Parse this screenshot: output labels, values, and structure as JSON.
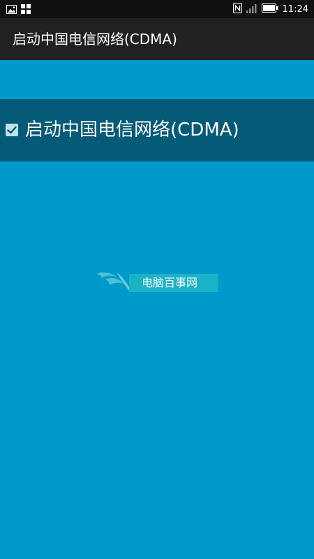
{
  "status_bar": {
    "time": "11:24",
    "icons": [
      "image-icon",
      "apps-grid-icon",
      "nfc-icon",
      "signal-icon",
      "battery-icon"
    ]
  },
  "title_bar": {
    "title": "启动中国电信网络(CDMA)"
  },
  "option": {
    "label": "启动中国电信网络(CDMA)",
    "checked": true
  },
  "watermark": {
    "text": "电脑百事网"
  },
  "colors": {
    "background": "#0099cc",
    "title_bar": "#212121",
    "option_row": "#055a78",
    "status_bar": "#111111"
  }
}
